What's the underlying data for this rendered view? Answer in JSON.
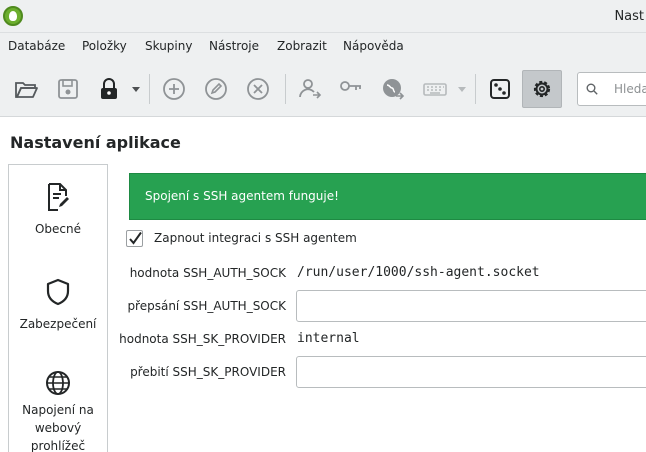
{
  "window": {
    "title": "Nastavení aplikace - KeePassXC",
    "title_visible": "Nast"
  },
  "menu": [
    "Databáze",
    "Položky",
    "Skupiny",
    "Nástroje",
    "Zobrazit",
    "Nápověda"
  ],
  "toolbar": {
    "buttons": [
      "open-database",
      "save-database",
      "lock-database",
      "add-entry",
      "edit-entry",
      "delete-entry",
      "transfer-entry",
      "copy-password",
      "open-url",
      "auto-type",
      "password-generator",
      "settings"
    ],
    "active": "settings"
  },
  "search": {
    "placeholder": "Hleda"
  },
  "page": {
    "title": "Nastavení aplikace"
  },
  "sidebar": {
    "items": [
      {
        "label": "Obecné",
        "icon": "document-edit-icon"
      },
      {
        "label": "Zabezpečení",
        "icon": "shield-icon"
      },
      {
        "label": "Napojení na webový prohlížeč",
        "icon": "globe-icon"
      }
    ]
  },
  "ssh": {
    "status_message": "Spojení s SSH agentem funguje!",
    "enable_label": "Zapnout integraci s SSH agentem",
    "enabled": true,
    "auth_sock_label": "hodnota SSH_AUTH_SOCK",
    "auth_sock_value": "/run/user/1000/ssh-agent.socket",
    "auth_sock_override_label": "přepsání SSH_AUTH_SOCK",
    "auth_sock_override_value": "",
    "sk_provider_label": "hodnota SSH_SK_PROVIDER",
    "sk_provider_value": "internal",
    "sk_provider_override_label": "přebití SSH_SK_PROVIDER",
    "sk_provider_override_value": ""
  },
  "colors": {
    "success": "#27a151",
    "toolbar_bg": "#eef0f1",
    "active_button": "#c4c8cb"
  }
}
